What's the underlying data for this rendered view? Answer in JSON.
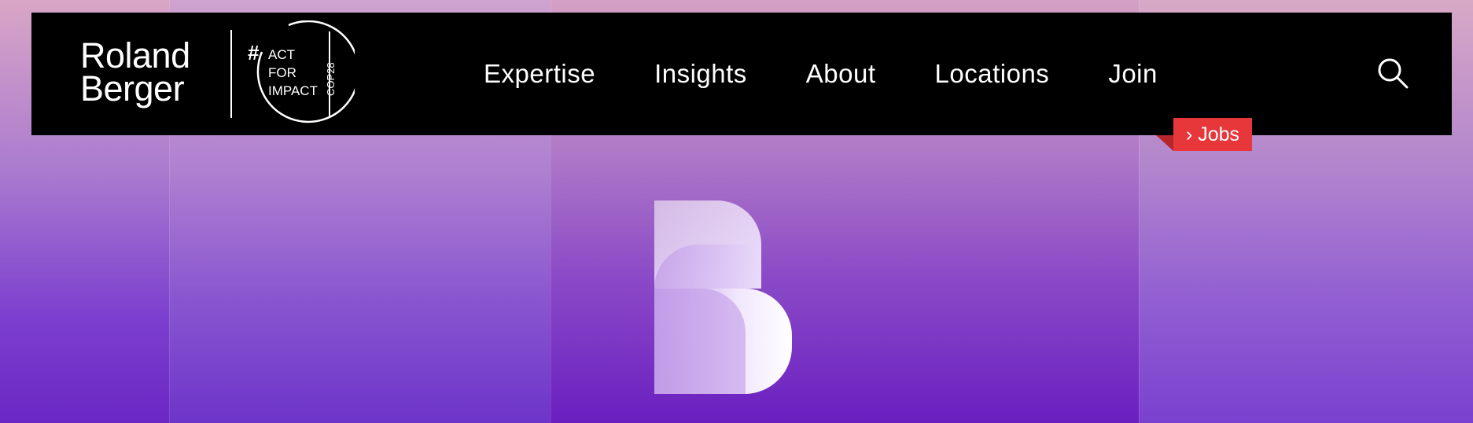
{
  "brand": {
    "line1": "Roland",
    "line2": "Berger"
  },
  "badge": {
    "hash": "#",
    "line1": "ACT",
    "line2": "FOR",
    "line3": "IMPACT",
    "side": "COP28"
  },
  "nav": {
    "items": [
      {
        "label": "Expertise"
      },
      {
        "label": "Insights"
      },
      {
        "label": "About"
      },
      {
        "label": "Locations"
      },
      {
        "label": "Join"
      }
    ]
  },
  "search": {
    "icon": "search-icon"
  },
  "jobs": {
    "label": "› Jobs"
  },
  "colors": {
    "navbar_bg": "#000000",
    "accent_red": "#e8373b",
    "hero_purple": "#6a22c2",
    "hero_pink": "#e0b2c6"
  }
}
